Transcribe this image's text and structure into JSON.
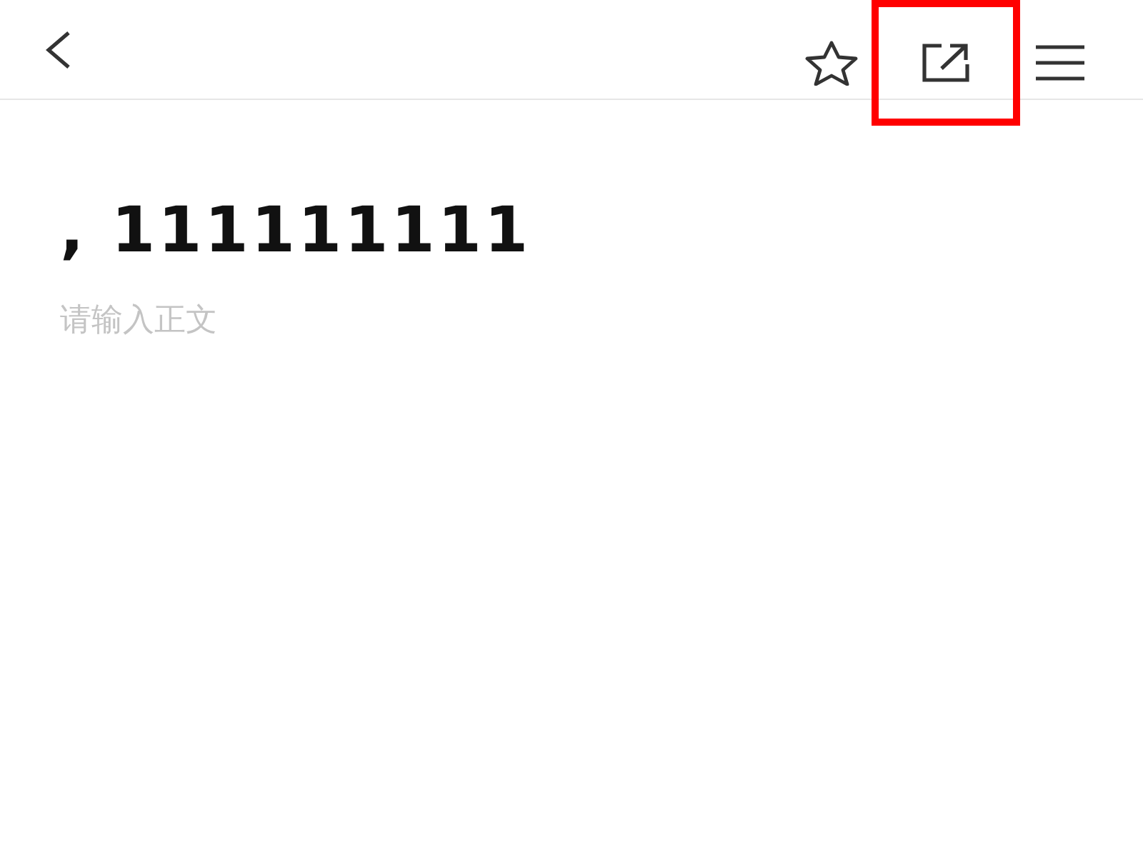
{
  "toolbar": {
    "actions": [
      {
        "kind": "star",
        "highlighted": false
      },
      {
        "kind": "share",
        "highlighted": true
      },
      {
        "kind": "menu",
        "highlighted": false
      }
    ]
  },
  "editor": {
    "title": ", 111111111",
    "body_placeholder": "请输入正文"
  }
}
